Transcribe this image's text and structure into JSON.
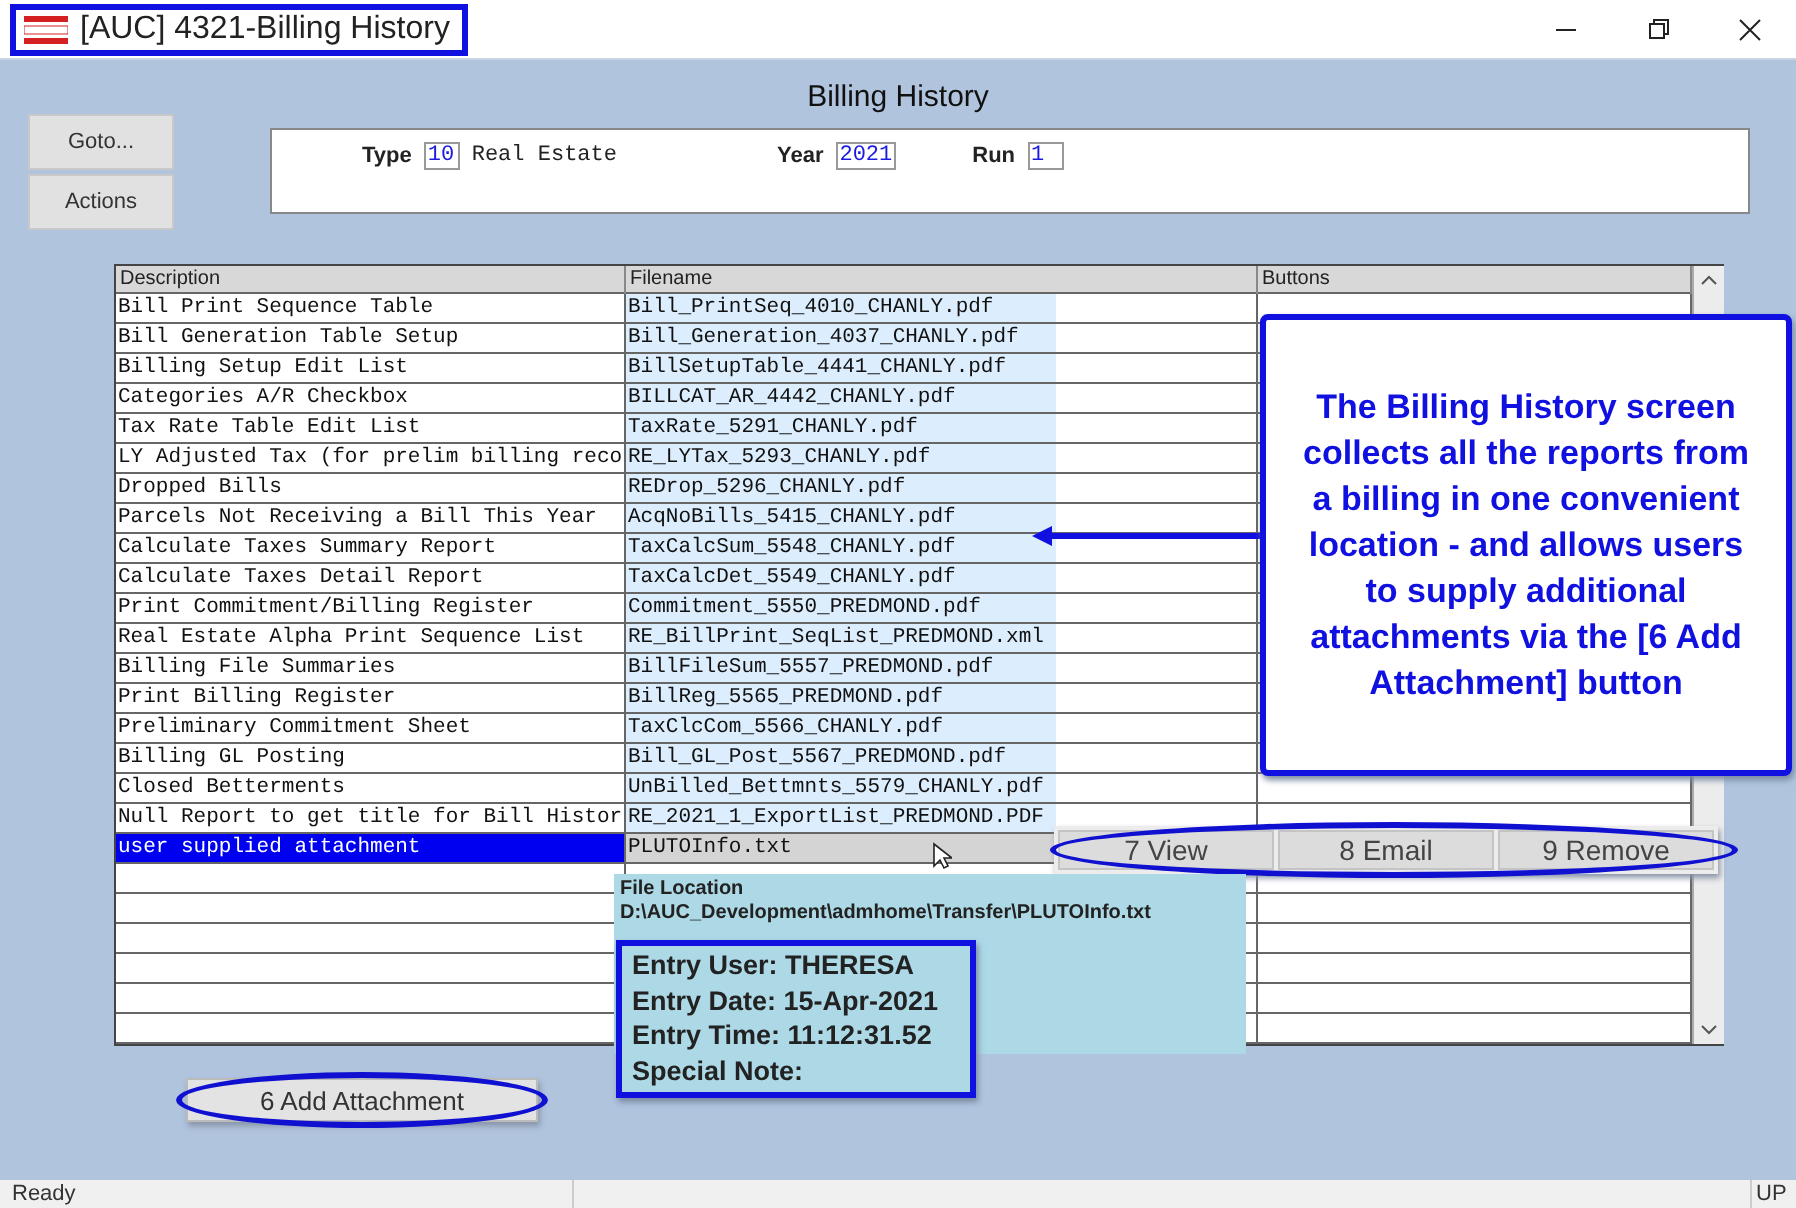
{
  "window": {
    "title": "[AUC] 4321-Billing History"
  },
  "header": {
    "title": "Billing History"
  },
  "side_buttons": [
    "Goto...",
    "Actions"
  ],
  "filters": [
    {
      "label": "Type",
      "value": "10",
      "description": "Real Estate"
    },
    {
      "label": "Year",
      "value": "2021"
    },
    {
      "label": "Run",
      "value": "1"
    }
  ],
  "table": {
    "columns": [
      "Description",
      "Filename",
      "Buttons"
    ],
    "rows": [
      {
        "description": "Bill Print Sequence Table",
        "filename": "Bill_PrintSeq_4010_CHANLY.pdf",
        "selected": false
      },
      {
        "description": "Bill Generation Table Setup",
        "filename": "Bill_Generation_4037_CHANLY.pdf",
        "selected": false
      },
      {
        "description": "Billing Setup Edit List",
        "filename": "BillSetupTable_4441_CHANLY.pdf",
        "selected": false
      },
      {
        "description": "Categories A/R Checkbox",
        "filename": "BILLCAT_AR_4442_CHANLY.pdf",
        "selected": false
      },
      {
        "description": "Tax Rate Table Edit List",
        "filename": "TaxRate_5291_CHANLY.pdf",
        "selected": false
      },
      {
        "description": "LY Adjusted Tax (for prelim billing reco",
        "filename": "RE_LYTax_5293_CHANLY.pdf",
        "selected": false
      },
      {
        "description": "Dropped Bills",
        "filename": "REDrop_5296_CHANLY.pdf",
        "selected": false
      },
      {
        "description": "Parcels Not Receiving a Bill This Year",
        "filename": "AcqNoBills_5415_CHANLY.pdf",
        "selected": false
      },
      {
        "description": "Calculate Taxes Summary Report",
        "filename": "TaxCalcSum_5548_CHANLY.pdf",
        "selected": false
      },
      {
        "description": "Calculate Taxes Detail Report",
        "filename": "TaxCalcDet_5549_CHANLY.pdf",
        "selected": false
      },
      {
        "description": "Print Commitment/Billing Register",
        "filename": "Commitment_5550_PREDMOND.pdf",
        "selected": false
      },
      {
        "description": "Real Estate Alpha Print Sequence List",
        "filename": "RE_BillPrint_SeqList_PREDMOND.xml",
        "selected": false
      },
      {
        "description": "Billing File Summaries",
        "filename": "BillFileSum_5557_PREDMOND.pdf",
        "selected": false
      },
      {
        "description": "Print Billing Register",
        "filename": "BillReg_5565_PREDMOND.pdf",
        "selected": false
      },
      {
        "description": "Preliminary Commitment Sheet",
        "filename": "TaxClcCom_5566_CHANLY.pdf",
        "selected": false
      },
      {
        "description": "Billing GL Posting",
        "filename": "Bill_GL_Post_5567_PREDMOND.pdf",
        "selected": false
      },
      {
        "description": "Closed Betterments",
        "filename": "UnBilled_Bettmnts_5579_CHANLY.pdf",
        "selected": false
      },
      {
        "description": "Null Report to get title for Bill Histor",
        "filename": "RE_2021_1_ExportList_PREDMOND.PDF",
        "selected": false
      },
      {
        "description": "user supplied attachment",
        "filename": "PLUTOInfo.txt",
        "selected": true
      }
    ]
  },
  "row_buttons": [
    "7 View",
    "8 Email",
    "9 Remove"
  ],
  "file_info": {
    "label": "File Location",
    "path": "D:\\AUC_Development\\admhome\\Transfer\\PLUTOInfo.txt",
    "details": [
      "Entry User: THERESA",
      "Entry Date: 15-Apr-2021",
      "Entry Time: 11:12:31.52",
      "Special Note:"
    ]
  },
  "add_button": "6 Add Attachment",
  "callout": {
    "text": "The Billing History screen collects all the reports from a billing in one convenient location - and allows users to supply additional attachments via the [6 Add Attachment] button"
  },
  "status_bar": {
    "message": "Ready",
    "indicator": "UP"
  }
}
